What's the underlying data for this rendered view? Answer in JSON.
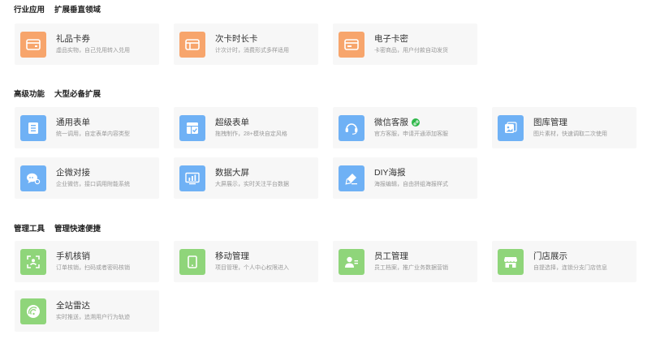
{
  "sections": [
    {
      "title": "行业应用",
      "subtitle": "扩展垂直领域",
      "cards": [
        {
          "name": "礼品卡券",
          "desc": "虚品实物，自己兑用转入兑用"
        },
        {
          "name": "次卡时长卡",
          "desc": "计次计时，消费形式多样适用"
        },
        {
          "name": "电子卡密",
          "desc": "卡密商品，用户付款自动发货"
        }
      ]
    },
    {
      "title": "高级功能",
      "subtitle": "大型必备扩展",
      "cards": [
        {
          "name": "通用表单",
          "desc": "统一调用，自定表单内容类型"
        },
        {
          "name": "超级表单",
          "desc": "拖拽制作，28+模块自定风格"
        },
        {
          "name": "微信客服",
          "desc": "官方客服，申请开通添加客服"
        },
        {
          "name": "图库管理",
          "desc": "图片素材，快速调取二次使用"
        },
        {
          "name": "企微对接",
          "desc": "企业微信，接口调用附能系统"
        },
        {
          "name": "数据大屏",
          "desc": "大屏展示，实时关注平台数据"
        },
        {
          "name": "DIY海报",
          "desc": "海报编辑，自由拼组海报样式"
        }
      ]
    },
    {
      "title": "管理工具",
      "subtitle": "管理快速便捷",
      "cards": [
        {
          "name": "手机核销",
          "desc": "订单核销，扫码或者密码核销"
        },
        {
          "name": "移动管理",
          "desc": "项目管理，个人中心权限进入"
        },
        {
          "name": "员工管理",
          "desc": "员工档案，推广业务数据营销"
        },
        {
          "name": "门店展示",
          "desc": "自提选择，连锁分支门店信息"
        },
        {
          "name": "全站雷达",
          "desc": "实时推送，追溯用户行为轨迹"
        }
      ]
    }
  ],
  "colors": {
    "orange": "#f7a56c",
    "blue": "#6fb1f5",
    "green": "#8fd57a",
    "badge": "#2fb84a"
  }
}
